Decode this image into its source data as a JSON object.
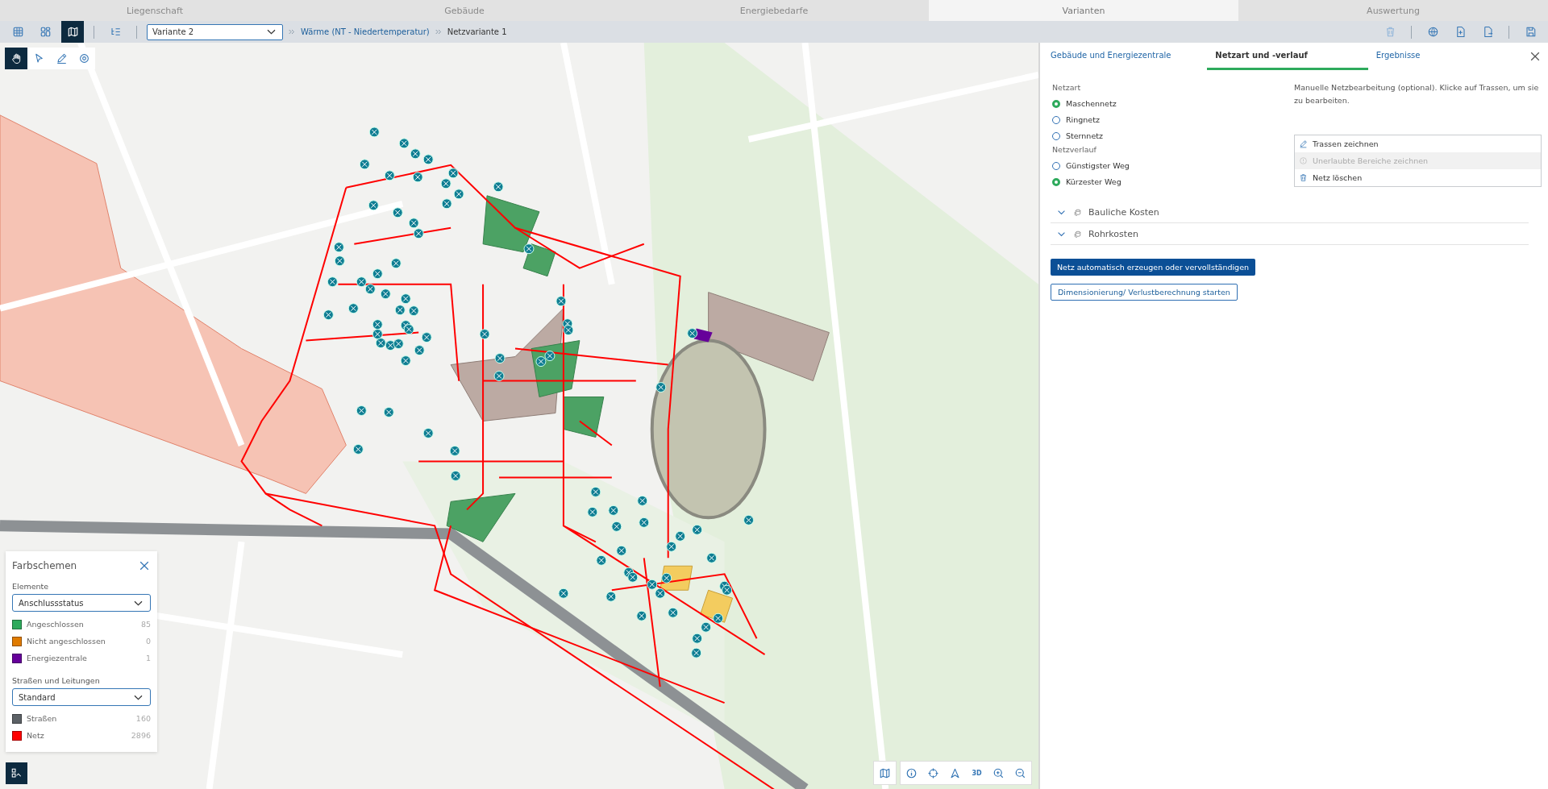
{
  "top_tabs": [
    {
      "label": "Liegenschaft",
      "selected": false
    },
    {
      "label": "Gebäude",
      "selected": false
    },
    {
      "label": "Energiebedarfe",
      "selected": false
    },
    {
      "label": "Varianten",
      "selected": true
    },
    {
      "label": "Auswertung",
      "selected": false
    }
  ],
  "toolbar": {
    "views": [
      {
        "kind": "grid",
        "selected": false
      },
      {
        "kind": "tiles",
        "selected": false
      },
      {
        "kind": "map",
        "selected": true
      }
    ],
    "variant_select": {
      "value": "Variante 2"
    },
    "breadcrumb": [
      {
        "label": "Wärme (NT - Niedertemperatur)",
        "kind": "link"
      },
      {
        "label": "Netzvariante 1",
        "kind": "current"
      }
    ],
    "actions": [
      {
        "kind": "delete",
        "disabled": true
      },
      {
        "kind": "globe",
        "disabled": false
      },
      {
        "kind": "import",
        "disabled": false
      },
      {
        "kind": "export",
        "disabled": false
      },
      {
        "kind": "save",
        "disabled": false
      }
    ]
  },
  "map_tools": [
    {
      "kind": "pan",
      "selected": true
    },
    {
      "kind": "select",
      "selected": false
    },
    {
      "kind": "draw",
      "selected": false
    },
    {
      "kind": "locate",
      "selected": false
    }
  ],
  "legend": {
    "title": "Farbschemen",
    "sections": [
      {
        "label": "Elemente",
        "select": "Anschlussstatus",
        "items": [
          {
            "label": "Angeschlossen",
            "count": "85",
            "color": "#2eaa5c"
          },
          {
            "label": "Nicht angeschlossen",
            "count": "0",
            "color": "#e07b00"
          },
          {
            "label": "Energiezentrale",
            "count": "1",
            "color": "#66009a"
          }
        ]
      },
      {
        "label": "Straßen und Leitungen",
        "select": "Standard",
        "items": [
          {
            "label": "Straßen",
            "count": "160",
            "color": "#5c6166"
          },
          {
            "label": "Netz",
            "count": "2896",
            "color": "#ff0000"
          }
        ]
      }
    ]
  },
  "map_controls": [
    {
      "kind": "layers"
    },
    {
      "kind": "info"
    },
    {
      "kind": "center"
    },
    {
      "kind": "north"
    },
    {
      "kind": "text",
      "label": "3D"
    },
    {
      "kind": "zoom-in"
    },
    {
      "kind": "zoom-out"
    }
  ],
  "panel": {
    "tabs": [
      {
        "label": "Gebäude und Energiezentrale",
        "selected": false
      },
      {
        "label": "Netzart und -verlauf",
        "selected": true
      },
      {
        "label": "Ergebnisse",
        "selected": false
      }
    ],
    "groups": [
      {
        "label": "Netzart",
        "options": [
          {
            "label": "Maschennetz",
            "selected": true
          },
          {
            "label": "Ringnetz",
            "selected": false
          },
          {
            "label": "Sternnetz",
            "selected": false
          }
        ]
      },
      {
        "label": "Netzverlauf",
        "options": [
          {
            "label": "Günstigster Weg",
            "selected": false
          },
          {
            "label": "Kürzester Weg",
            "selected": true
          }
        ]
      }
    ],
    "hint": "Manuelle Netzbearbeitung (optional). Klicke auf Trassen, um sie zu bearbeiten.",
    "edit_actions": [
      {
        "kind": "pencil",
        "label": "Trassen zeichnen",
        "disabled": false
      },
      {
        "kind": "warning",
        "label": "Unerlaubte Bereiche zeichnen",
        "disabled": true
      },
      {
        "kind": "trash",
        "label": "Netz löschen",
        "disabled": false
      }
    ],
    "accordions": [
      {
        "label": "Bauliche Kosten"
      },
      {
        "label": "Rohrkosten"
      }
    ],
    "primary_button": "Netz automatisch erzeugen oder vervollständigen",
    "secondary_button": "Dimensionierung/ Verlustberechnung starten"
  }
}
